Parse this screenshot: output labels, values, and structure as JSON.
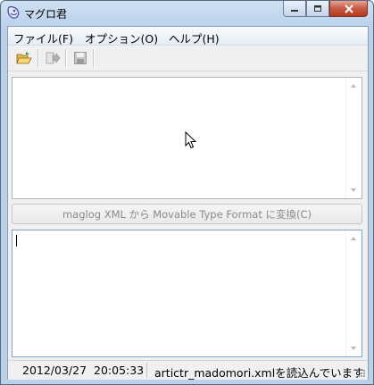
{
  "window": {
    "title": "マグロ君"
  },
  "menu": {
    "file": "ファイル(F)",
    "options": "オプション(O)",
    "help": "ヘルプ(H)"
  },
  "toolbar": {
    "icons": [
      "open-folder-icon",
      "export-icon",
      "save-disk-icon"
    ]
  },
  "convert_button": {
    "label": "maglog XML から Movable Type Format に変換(C)"
  },
  "status": {
    "datetime": "2012/03/27  20:05:33",
    "message": "artictr_madomori.xmlを読込んでいます"
  }
}
